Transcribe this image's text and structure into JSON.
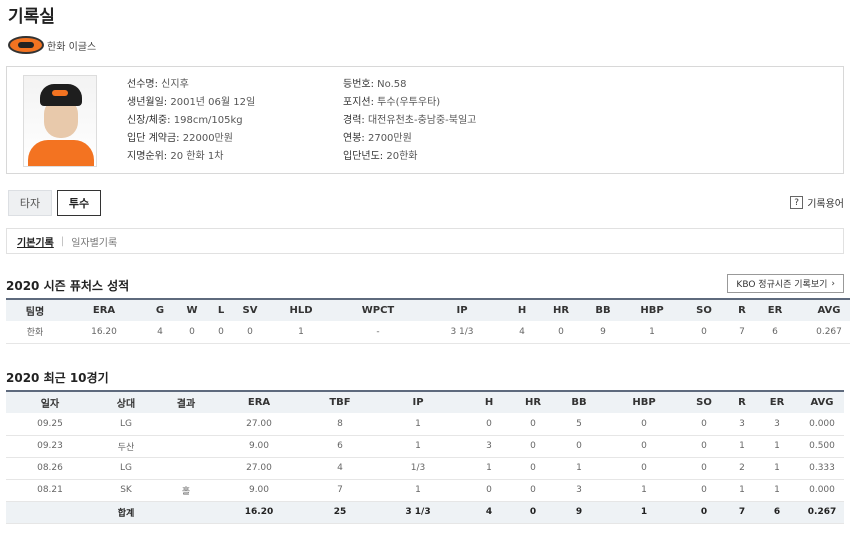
{
  "page": {
    "title": "기록실"
  },
  "team": {
    "name": "한화 이글스"
  },
  "player": {
    "left": [
      {
        "k": "선수명:",
        "v": "신지후"
      },
      {
        "k": "생년월일:",
        "v": "2001년 06월 12일"
      },
      {
        "k": "신장/체중:",
        "v": "198cm/105kg"
      },
      {
        "k": "입단 계약금:",
        "v": "22000만원"
      },
      {
        "k": "지명순위:",
        "v": "20 한화 1차"
      }
    ],
    "right": [
      {
        "k": "등번호:",
        "v": "No.58"
      },
      {
        "k": "포지션:",
        "v": "투수(우투우타)"
      },
      {
        "k": "경력:",
        "v": "대전유천초-충남중-북일고"
      },
      {
        "k": "연봉:",
        "v": "2700만원"
      },
      {
        "k": "입단년도:",
        "v": "20한화"
      }
    ]
  },
  "tabs": {
    "batter": "타자",
    "pitcher": "투수"
  },
  "glossary": {
    "icon": "?",
    "label": "기록용어"
  },
  "subtabs": {
    "basic": "기본기록",
    "separator": "|",
    "daily": "일자별기록"
  },
  "season": {
    "title": "2020 시즌 퓨처스 성적",
    "kbo_button": "KBO 정규시즌 기록보기",
    "kbo_arrow": "›",
    "headers": [
      "팀명",
      "ERA",
      "G",
      "W",
      "L",
      "SV",
      "HLD",
      "WPCT",
      "IP",
      "H",
      "HR",
      "BB",
      "HBP",
      "SO",
      "R",
      "ER",
      "AVG"
    ],
    "rows": [
      [
        "한화",
        "16.20",
        "4",
        "0",
        "0",
        "0",
        "1",
        "-",
        "3 1/3",
        "4",
        "0",
        "9",
        "1",
        "0",
        "7",
        "6",
        "0.267"
      ]
    ]
  },
  "recent": {
    "title": "2020 최근 10경기",
    "headers": [
      "일자",
      "상대",
      "결과",
      "ERA",
      "TBF",
      "IP",
      "H",
      "HR",
      "BB",
      "HBP",
      "SO",
      "R",
      "ER",
      "AVG"
    ],
    "rows": [
      [
        "09.25",
        "LG",
        "",
        "27.00",
        "8",
        "1",
        "0",
        "0",
        "5",
        "0",
        "0",
        "3",
        "3",
        "0.000"
      ],
      [
        "09.23",
        "두산",
        "",
        "9.00",
        "6",
        "1",
        "3",
        "0",
        "0",
        "0",
        "0",
        "1",
        "1",
        "0.500"
      ],
      [
        "08.26",
        "LG",
        "",
        "27.00",
        "4",
        "1/3",
        "1",
        "0",
        "1",
        "0",
        "0",
        "2",
        "1",
        "0.333"
      ],
      [
        "08.21",
        "SK",
        "홀",
        "9.00",
        "7",
        "1",
        "0",
        "0",
        "3",
        "1",
        "0",
        "1",
        "1",
        "0.000"
      ]
    ],
    "total": [
      "",
      "합계",
      "",
      "16.20",
      "25",
      "3 1/3",
      "4",
      "0",
      "9",
      "1",
      "0",
      "7",
      "6",
      "0.267"
    ]
  }
}
